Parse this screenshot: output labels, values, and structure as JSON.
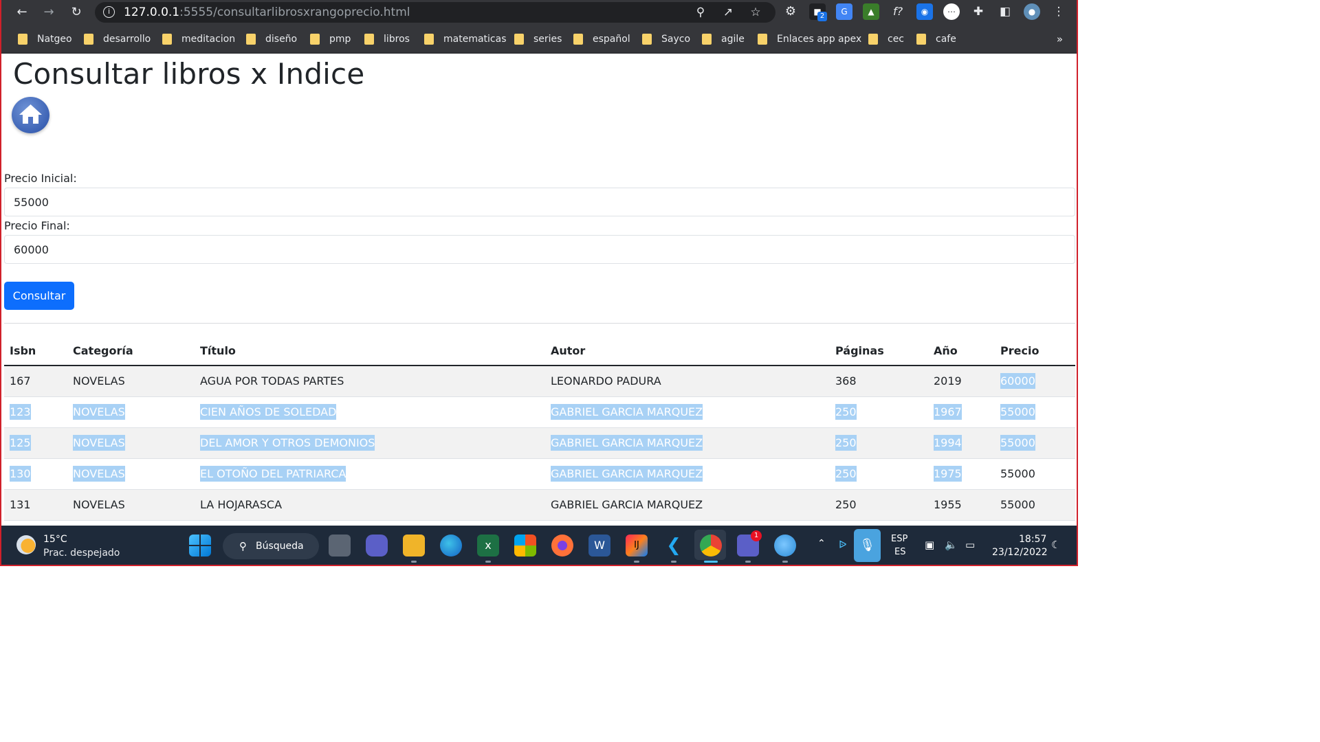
{
  "browser": {
    "url_host": "127.0.0.1",
    "url_rest": ":5555/consultarlibrosxrangoprecio.html",
    "extension_badge": "2",
    "bookmarks": [
      "Natgeo",
      "desarrollo",
      "meditacion",
      "diseño",
      "pmp",
      "libros",
      "matematicas",
      "series",
      "español",
      "Sayco",
      "agile",
      "Enlaces app apex",
      "cec",
      "cafe"
    ],
    "more": "»"
  },
  "page": {
    "title": "Consultar libros x Indice",
    "precio_inicial_label": "Precio Inicial:",
    "precio_inicial_value": "55000",
    "precio_final_label": "Precio Final:",
    "precio_final_value": "60000",
    "consultar_button": "Consultar"
  },
  "table": {
    "headers": [
      "Isbn",
      "Categoría",
      "Título",
      "Autor",
      "Páginas",
      "Año",
      "Precio"
    ],
    "rows": [
      [
        "167",
        "NOVELAS",
        "AGUA POR TODAS PARTES",
        "LEONARDO PADURA",
        "368",
        "2019",
        "60000"
      ],
      [
        "123",
        "NOVELAS",
        "CIEN AÑOS DE SOLEDAD",
        "GABRIEL GARCIA MARQUEZ",
        "250",
        "1967",
        "55000"
      ],
      [
        "125",
        "NOVELAS",
        "DEL AMOR Y OTROS DEMONIOS",
        "GABRIEL GARCIA MARQUEZ",
        "250",
        "1994",
        "55000"
      ],
      [
        "130",
        "NOVELAS",
        "EL OTOÑO DEL PATRIARCA",
        "GABRIEL GARCIA MARQUEZ",
        "250",
        "1975",
        "55000"
      ],
      [
        "131",
        "NOVELAS",
        "LA HOJARASCA",
        "GABRIEL GARCIA MARQUEZ",
        "250",
        "1955",
        "55000"
      ]
    ]
  },
  "taskbar": {
    "weather_temp": "15°C",
    "weather_desc": "Prac. despejado",
    "search_label": "Búsqueda",
    "teams_badge": "1",
    "lang_line1": "ESP",
    "lang_line2": "ES",
    "time": "18:57",
    "date": "23/12/2022"
  }
}
